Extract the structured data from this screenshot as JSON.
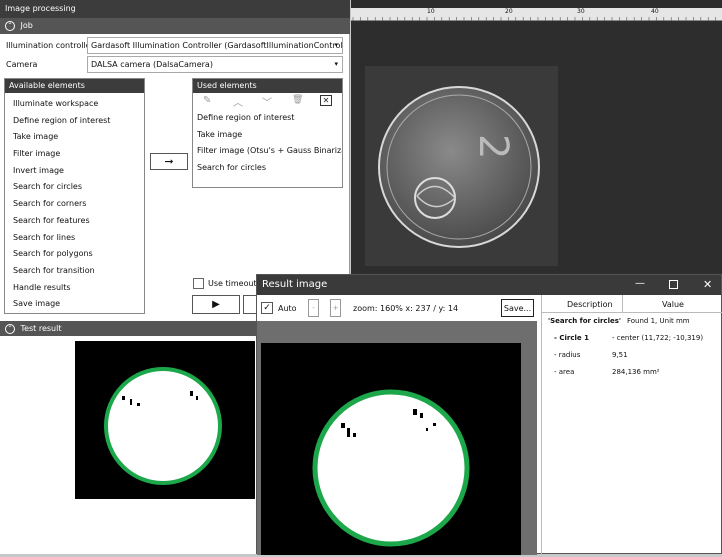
{
  "app": {
    "title": "Image processing"
  },
  "job": {
    "section_title": "Job",
    "illumination_label": "Illumination controller",
    "illumination_value": "Gardasoft Illumination Controller (GardasoftIlluminationController)",
    "camera_label": "Camera",
    "camera_value": "DALSA camera (DalsaCamera)"
  },
  "available": {
    "header": "Available elements",
    "items": [
      "Illuminate workspace",
      "Define region of interest",
      "Take image",
      "Filter image",
      "Invert image",
      "Search for circles",
      "Search for corners",
      "Search for features",
      "Search for lines",
      "Search for polygons",
      "Search for transition",
      "Handle results",
      "Save image"
    ]
  },
  "used": {
    "header": "Used elements",
    "items": [
      "Define region of interest",
      "Take image",
      "Filter image (Otsu's + Gauss Binarization )",
      "Search for circles"
    ]
  },
  "controls": {
    "use_timeouts_label": "Use timeouts"
  },
  "test_result": {
    "section_title": "Test result"
  },
  "ruler": {
    "labels": [
      "10",
      "20",
      "30",
      "40"
    ]
  },
  "result_window": {
    "title": "Result image",
    "auto_label": "Auto",
    "zoom_text": "zoom: 160% x: 237 / y: 14",
    "save_label": "Save...",
    "table": {
      "col_description": "Description",
      "col_value": "Value",
      "rows": [
        {
          "d": "'Search for circles'",
          "v": "Found  1, Unit  mm"
        },
        {
          "d": "- Circle 1",
          "v": "- center  (11,722; -10,319)"
        },
        {
          "d": "- radius",
          "v": "9,51"
        },
        {
          "d": "- area",
          "v": "284,136 mm²"
        }
      ]
    }
  },
  "colors": {
    "accent": "#3c3c3c",
    "circle": "#1ca84a"
  }
}
